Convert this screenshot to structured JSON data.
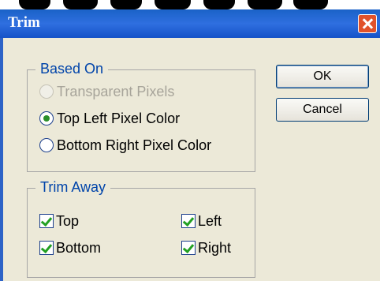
{
  "window": {
    "title": "Trim"
  },
  "based_on": {
    "legend": "Based On",
    "options": [
      {
        "label": "Transparent Pixels",
        "checked": false,
        "disabled": true
      },
      {
        "label": "Top Left Pixel Color",
        "checked": true,
        "disabled": false
      },
      {
        "label": "Bottom Right Pixel Color",
        "checked": false,
        "disabled": false
      }
    ]
  },
  "trim_away": {
    "legend": "Trim Away",
    "items": [
      {
        "label": "Top",
        "checked": true
      },
      {
        "label": "Left",
        "checked": true
      },
      {
        "label": "Bottom",
        "checked": true
      },
      {
        "label": "Right",
        "checked": true
      }
    ]
  },
  "buttons": {
    "ok": "OK",
    "cancel": "Cancel"
  },
  "colors": {
    "titlebar": "#2f6fe0",
    "dialog_bg": "#ece9d8",
    "close": "#e1522b",
    "legend_text": "#0044aa"
  }
}
